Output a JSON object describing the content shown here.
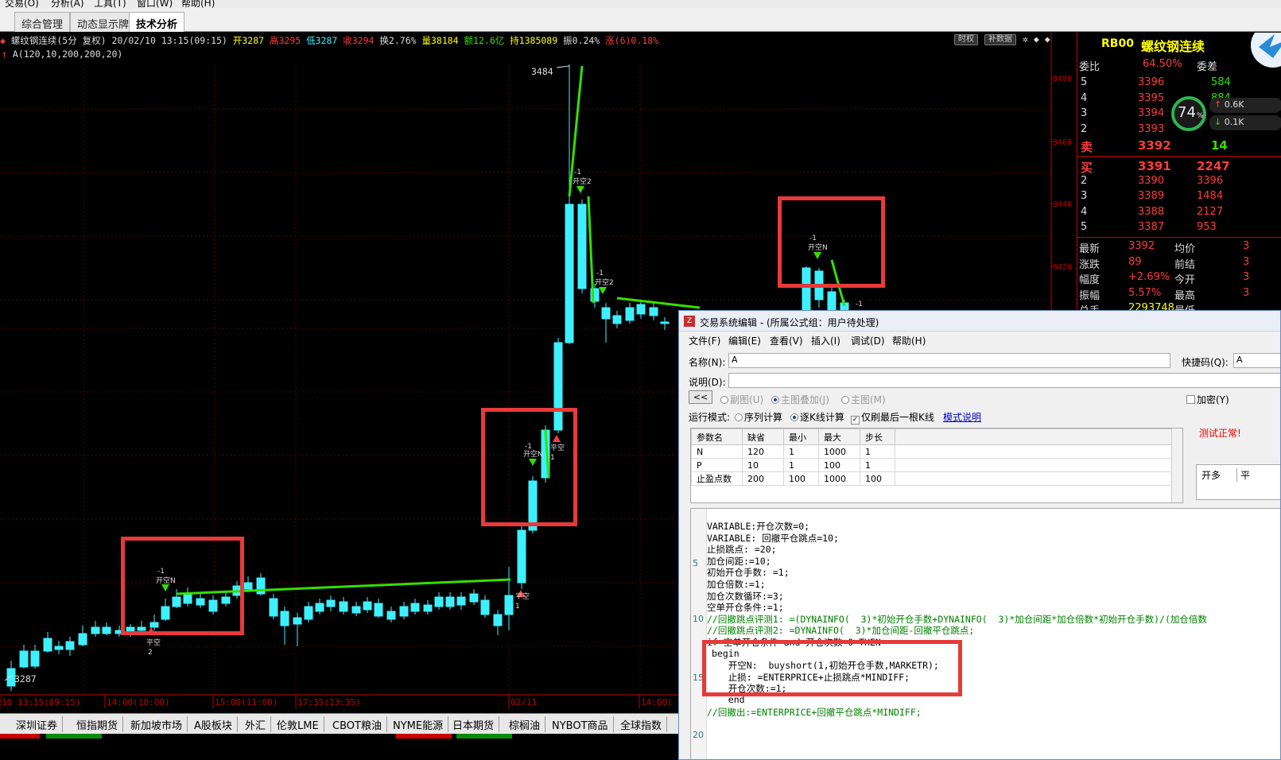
{
  "menubar": {
    "items": [
      "交易(O)",
      "分析(A)",
      "工具(T)",
      "窗口(W)",
      "帮助(H)"
    ]
  },
  "tabs": [
    "综合管理",
    "动态显示牌",
    "技术分析"
  ],
  "chart_info": {
    "name": "螺纹钢连续(5分 复权)",
    "datetime": "20/02/10 13:15(09:15)",
    "open": "开3287",
    "high": "高3295",
    "low": "低3287",
    "close": "收3294",
    "turnover": "换2.76%",
    "volume": "量38184",
    "amount": "额12.6亿",
    "hold": "持1385089",
    "amplitude": "振0.24%",
    "change": "涨(6)0.18%",
    "indicator": "A(120,10,200,200,20)",
    "btn_time": "时权",
    "btn_fill": "补数据",
    "max_label": "3484",
    "min_label": "3287"
  },
  "y_axis": [
    "3480",
    "3460",
    "3440",
    "3420"
  ],
  "x_axis": [
    "10 13:15(09:15)",
    "14:00(10:00)",
    "15:00(11:00)",
    "17:35(13:35)",
    "02/11",
    "14:00("
  ],
  "signals": {
    "open_short_n": "开空N",
    "open_short_2": "开空2",
    "close_short": "平空",
    "minus_one": "-1",
    "one": "1",
    "two": "2"
  },
  "quote": {
    "symbol": "RB00",
    "name": "螺纹钢连续",
    "ratio_label": "委比",
    "ratio_value": "64.50%",
    "diff_label": "委差",
    "gauge": "74",
    "gauge_unit": "%",
    "speed_up": "0.6K",
    "speed_down": "0.1K",
    "sell": [
      {
        "lv": "5",
        "price": "3396",
        "vol": "584"
      },
      {
        "lv": "4",
        "price": "3395",
        "vol": "884"
      },
      {
        "lv": "3",
        "price": "3394",
        "vol": ""
      },
      {
        "lv": "2",
        "price": "3393",
        "vol": ""
      },
      {
        "lv": "卖",
        "price": "3392",
        "vol": "14"
      }
    ],
    "buy": [
      {
        "lv": "买",
        "price": "3391",
        "vol": "2247"
      },
      {
        "lv": "2",
        "price": "3390",
        "vol": "3396"
      },
      {
        "lv": "3",
        "price": "3389",
        "vol": "1484"
      },
      {
        "lv": "4",
        "price": "3388",
        "vol": "2127"
      },
      {
        "lv": "5",
        "price": "3387",
        "vol": "953"
      }
    ],
    "stats": [
      {
        "label": "最新",
        "value": "3392",
        "label2": "均价",
        "value2": "3"
      },
      {
        "label": "涨跌",
        "value": "89",
        "label2": "前结",
        "value2": "3"
      },
      {
        "label": "幅度",
        "value": "+2.69%",
        "label2": "今开",
        "value2": "3"
      },
      {
        "label": "振幅",
        "value": "5.57%",
        "label2": "最高",
        "value2": "3"
      },
      {
        "label": "总手",
        "value": "2293748",
        "label2": "最低",
        "value2": ""
      }
    ]
  },
  "bottom_tabs": [
    "深圳证券",
    "恒指期货",
    "新加坡市场",
    "A股板块",
    "外汇",
    "伦敦LME",
    "CBOT粮油",
    "NYME能源",
    "日本期货",
    "棕榈油",
    "NYBOT商品",
    "全球指数"
  ],
  "dialog": {
    "title": "交易系统编辑 - (所属公式组：用户待处理)",
    "menu": [
      "文件(F)",
      "编辑(E)",
      "查看(V)",
      "插入(I)",
      "调试(D)",
      "帮助(H)"
    ],
    "name_label": "名称(N):",
    "name_value": "A",
    "hotkey_label": "快捷码(Q):",
    "hotkey_value": "A",
    "desc_label": "说明(D):",
    "back_button": "<<",
    "opt_sub": "副图(U)",
    "opt_main_overlay": "主图叠加(J)",
    "opt_main": "主图(M)",
    "encrypt": "加密(Y)",
    "run_mode_label": "运行模式:",
    "run_seq": "序列计算",
    "run_kline": "逐K线计算",
    "only_last": "仅刷最后一根K线",
    "mode_help": "模式说明",
    "test_ok": "测试正常!",
    "btn_open_long": "开多",
    "btn_close": "平",
    "param_headers": [
      "参数名",
      "缺省",
      "最小",
      "最大",
      "步长"
    ],
    "params": [
      [
        "N",
        "120",
        "1",
        "1000",
        "1"
      ],
      [
        "P",
        "10",
        "1",
        "100",
        "1"
      ],
      [
        "止盈点数",
        "200",
        "100",
        "1000",
        "100"
      ]
    ],
    "line_numbers": [
      "5",
      "10",
      "15",
      "20"
    ],
    "code": [
      "VARIABLE:开仓次数=0;",
      "VARIABLE: 回撤平仓跳点=10;",
      "止损跳点: =20;",
      "加仓间距:=10;",
      "初始开仓手数: =1;",
      "加仓倍数:=1;",
      "加仓次数循环:=3;",
      "空单开仓条件:=1;",
      "//回撤跳点评测1: =(DYNAINFO(  3)*初始开仓手数+DYNAINFO(  3)*加仓间距*加仓倍数*初始开仓手数)/(加仓倍数",
      "//回撤跳点评测2: =DYNAINFO(  3)*加仓间距-回撤平仓跳点;",
      "if 空单开仓条件 and 开仓次数=0 THEN",
      "begin",
      "   开空N:  buyshort(1,初始开仓手数,MARKETR);",
      "   止损: =ENTERPRICE+止损跳点*MINDIFF;",
      "   开仓次数:=1;",
      "   end",
      "//回撤出:=ENTERPRICE+回撤平仓跳点*MINDIFF;"
    ]
  },
  "colors": {
    "up": "#ff3b3b",
    "down": "#3ef0ff",
    "signal": "#33e000",
    "accent_red": "#e83a3a",
    "axis_red": "#c00000",
    "yellow": "#ffff00"
  }
}
